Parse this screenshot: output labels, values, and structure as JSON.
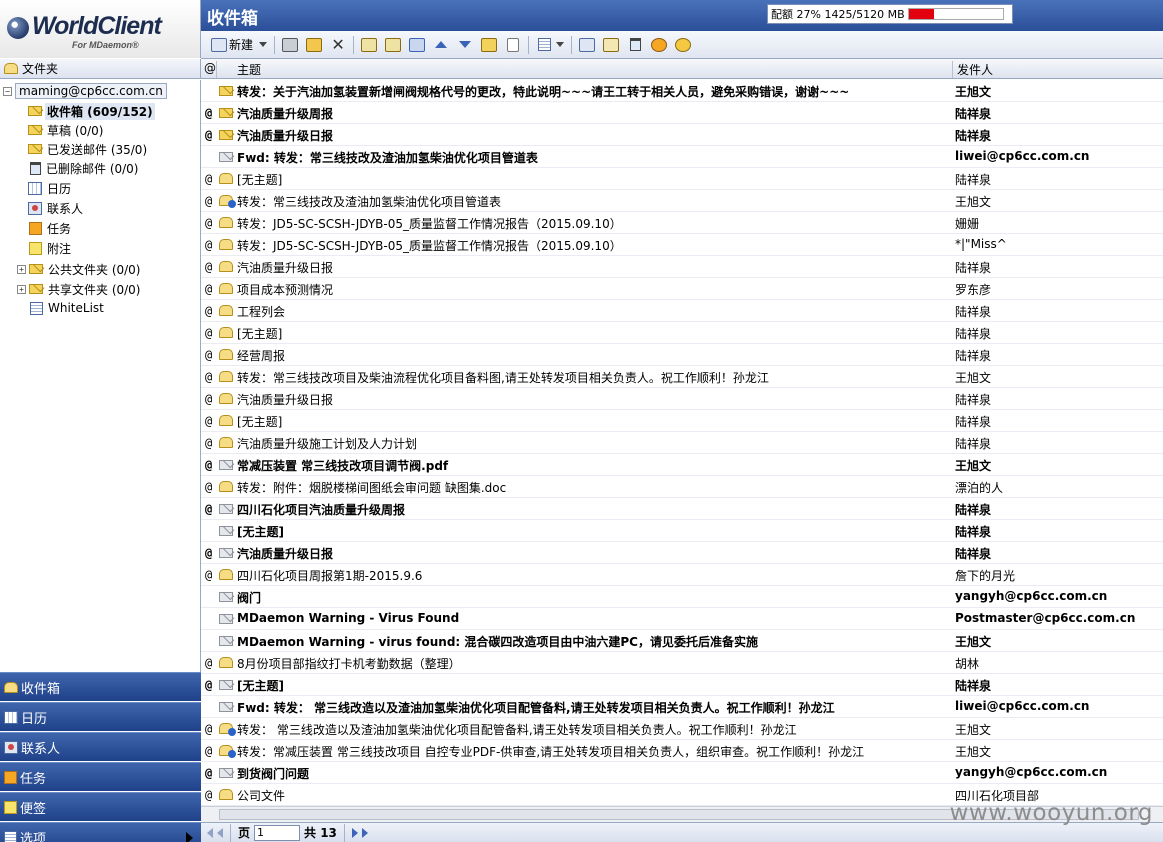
{
  "app": {
    "brand": "WorldClient",
    "brand_sub": "For MDaemon®"
  },
  "header": {
    "title": "收件箱"
  },
  "quota": {
    "label": "配额 27% 1425/5120 MB",
    "percent": 27
  },
  "toolbar": {
    "new_label": "新建"
  },
  "folder_pane": {
    "header": "文件夹",
    "account": "maming@cp6cc.com.cn",
    "folders": [
      {
        "label": "收件箱 (609/152)",
        "icon": "envelope-icon"
      },
      {
        "label": "草稿 (0/0)",
        "icon": "envelope-icon"
      },
      {
        "label": "已发送邮件 (35/0)",
        "icon": "envelope-icon"
      },
      {
        "label": "已删除邮件 (0/0)",
        "icon": "trash-icon"
      },
      {
        "label": "日历",
        "icon": "calendar-icon"
      },
      {
        "label": "联系人",
        "icon": "contacts-icon"
      },
      {
        "label": "任务",
        "icon": "tasks-icon"
      },
      {
        "label": "附注",
        "icon": "notes-icon"
      },
      {
        "label": "公共文件夹 (0/0)",
        "icon": "envelope-icon"
      },
      {
        "label": "共享文件夹 (0/0)",
        "icon": "envelope-icon"
      },
      {
        "label": "WhiteList",
        "icon": "list-icon"
      }
    ]
  },
  "nav": [
    {
      "label": "收件箱"
    },
    {
      "label": "日历"
    },
    {
      "label": "联系人"
    },
    {
      "label": "任务"
    },
    {
      "label": "便签"
    },
    {
      "label": "选项"
    }
  ],
  "list_header": {
    "attach": "@",
    "subject": "主题",
    "sender": "发件人"
  },
  "messages": [
    {
      "att": "",
      "status": "unread",
      "subject": "转发：关于汽油加氢装置新增闸阀规格代号的更改，特此说明~~~请王工转于相关人员，避免采购错误，谢谢~~~",
      "sender": "王旭文"
    },
    {
      "att": "@",
      "status": "unread",
      "subject": "汽油质量升级周报",
      "sender": "陆祥泉"
    },
    {
      "att": "@",
      "status": "unread",
      "subject": "汽油质量升级日报",
      "sender": "陆祥泉"
    },
    {
      "att": "",
      "status": "unread-grey",
      "subject": "Fwd: 转发：常三线技改及渣油加氢柴油优化项目管道表",
      "sender": "liwei@cp6cc.com.cn"
    },
    {
      "att": "@",
      "status": "read",
      "subject": "[无主题]",
      "sender": "陆祥泉"
    },
    {
      "att": "@",
      "status": "forwarded",
      "subject": "转发：常三线技改及渣油加氢柴油优化项目管道表",
      "sender": "王旭文"
    },
    {
      "att": "@",
      "status": "read",
      "subject": "转发：JD5-SC-SCSH-JDYB-05_质量监督工作情况报告（2015.09.10）",
      "sender": "姗姗"
    },
    {
      "att": "@",
      "status": "read",
      "subject": "转发：JD5-SC-SCSH-JDYB-05_质量监督工作情况报告（2015.09.10）",
      "sender": "*|\"Miss^"
    },
    {
      "att": "@",
      "status": "read",
      "subject": "汽油质量升级日报",
      "sender": "陆祥泉"
    },
    {
      "att": "@",
      "status": "read",
      "subject": "项目成本预测情况",
      "sender": "罗东彦"
    },
    {
      "att": "@",
      "status": "read",
      "subject": "工程列会",
      "sender": "陆祥泉"
    },
    {
      "att": "@",
      "status": "read",
      "subject": "[无主题]",
      "sender": "陆祥泉"
    },
    {
      "att": "@",
      "status": "read",
      "subject": "经营周报",
      "sender": "陆祥泉"
    },
    {
      "att": "@",
      "status": "read",
      "subject": "转发：常三线技改项目及柴油流程优化项目备料图,请王处转发项目相关负责人。祝工作顺利！孙龙江",
      "sender": "王旭文"
    },
    {
      "att": "@",
      "status": "read",
      "subject": "汽油质量升级日报",
      "sender": "陆祥泉"
    },
    {
      "att": "@",
      "status": "read",
      "subject": "[无主题]",
      "sender": "陆祥泉"
    },
    {
      "att": "@",
      "status": "read",
      "subject": "汽油质量升级施工计划及人力计划",
      "sender": "陆祥泉"
    },
    {
      "att": "@",
      "status": "unread-grey",
      "subject": "常减压装置 常三线技改项目调节阀.pdf",
      "sender": "王旭文"
    },
    {
      "att": "@",
      "status": "read",
      "subject": "转发：附件：烟脱楼梯间图纸会审问题 缺图集.doc",
      "sender": "漂泊的人"
    },
    {
      "att": "@",
      "status": "unread-grey",
      "subject": "四川石化项目汽油质量升级周报",
      "sender": "陆祥泉"
    },
    {
      "att": "",
      "status": "unread-grey",
      "subject": "[无主题]",
      "sender": "陆祥泉"
    },
    {
      "att": "@",
      "status": "unread-grey",
      "subject": "汽油质量升级日报",
      "sender": "陆祥泉"
    },
    {
      "att": "@",
      "status": "read",
      "subject": "四川石化项目周报第1期-2015.9.6",
      "sender": "詹下的月光"
    },
    {
      "att": "",
      "status": "unread-grey",
      "subject": "阀门",
      "sender": "yangyh@cp6cc.com.cn"
    },
    {
      "att": "",
      "status": "unread-grey",
      "subject": "MDaemon Warning - Virus Found",
      "sender": "Postmaster@cp6cc.com.cn"
    },
    {
      "att": "",
      "status": "unread-grey",
      "subject": "MDaemon Warning - virus found: 混合碳四改造项目由中油六建PC，请见委托后准备实施",
      "sender": "王旭文"
    },
    {
      "att": "@",
      "status": "read",
      "subject": "8月份项目部指纹打卡机考勤数据（整理）",
      "sender": "胡林"
    },
    {
      "att": "@",
      "status": "unread-grey",
      "subject": "[无主题]",
      "sender": "陆祥泉"
    },
    {
      "att": "",
      "status": "unread-grey",
      "subject": "Fwd: 转发： 常三线改造以及渣油加氢柴油优化项目配管备料,请王处转发项目相关负责人。祝工作顺利！孙龙江",
      "sender": "liwei@cp6cc.com.cn"
    },
    {
      "att": "@",
      "status": "forwarded",
      "subject": "转发： 常三线改造以及渣油加氢柴油优化项目配管备料,请王处转发项目相关负责人。祝工作顺利！孙龙江",
      "sender": "王旭文"
    },
    {
      "att": "@",
      "status": "forwarded",
      "subject": "转发：常减压装置 常三线技改项目 自控专业PDF-供审查,请王处转发项目相关负责人，组织审查。祝工作顺利！孙龙江",
      "sender": "王旭文"
    },
    {
      "att": "@",
      "status": "unread-grey",
      "subject": "到货阀门问题",
      "sender": "yangyh@cp6cc.com.cn"
    },
    {
      "att": "@",
      "status": "read",
      "subject": "公司文件",
      "sender": "四川石化项目部"
    }
  ],
  "pager": {
    "page_label": "页",
    "page_value": "1",
    "total_label": "共 13"
  },
  "watermark": "www.wooyun.org",
  "colors": {
    "title_bar": "#2a4f98",
    "nav": "#1f4189",
    "quota_fill": "#e3000f"
  }
}
